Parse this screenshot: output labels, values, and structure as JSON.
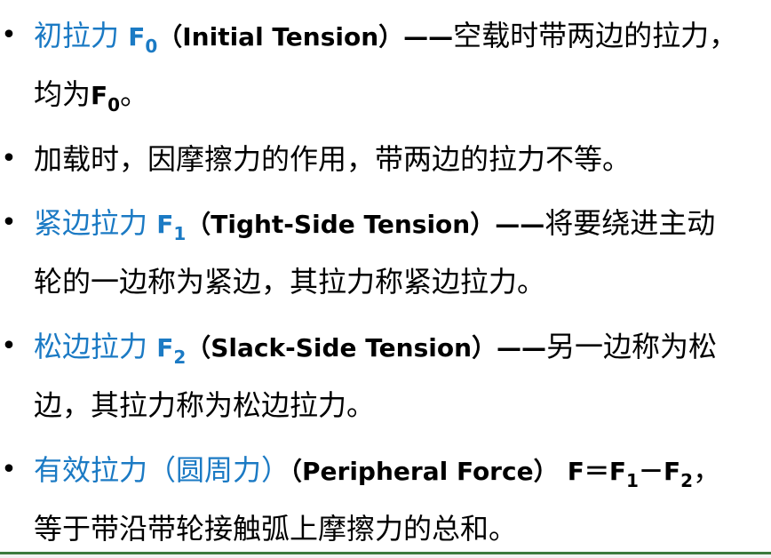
{
  "bullet_char": "•",
  "items": [
    {
      "term": "初拉力",
      "symbol": "F",
      "subscript": "0",
      "english": "（Initial Tension）",
      "dash": "——",
      "desc_line1": "空载时带两边的拉力，",
      "desc_line2_text": "均为",
      "desc_line2_symbol": "F",
      "desc_line2_subscript": "0",
      "desc_line2_end": "。"
    },
    {
      "text": "加载时，因摩擦力的作用，带两边的拉力不等。"
    },
    {
      "term": "紧边拉力",
      "symbol": "F",
      "subscript": "1",
      "english": "（Tight-Side Tension）",
      "dash": "——",
      "desc_line1": "将要绕进主动",
      "desc_line2": "轮的一边称为紧边，其拉力称紧边拉力。"
    },
    {
      "term": "松边拉力",
      "symbol": "F",
      "subscript": "2",
      "english": "（Slack-Side Tension）",
      "dash": "——",
      "desc_line1": "另一边称为松",
      "desc_line2": "边，其拉力称为松边拉力。"
    },
    {
      "term": "有效拉力（圆周力）",
      "english": "（Peripheral Force）",
      "formula_lhs": "F＝F",
      "formula_sub1": "1",
      "formula_minus": "－F",
      "formula_sub2": "2",
      "formula_end": "，",
      "desc_line2": "等于带沿带轮接触弧上摩擦力的总和。"
    }
  ]
}
